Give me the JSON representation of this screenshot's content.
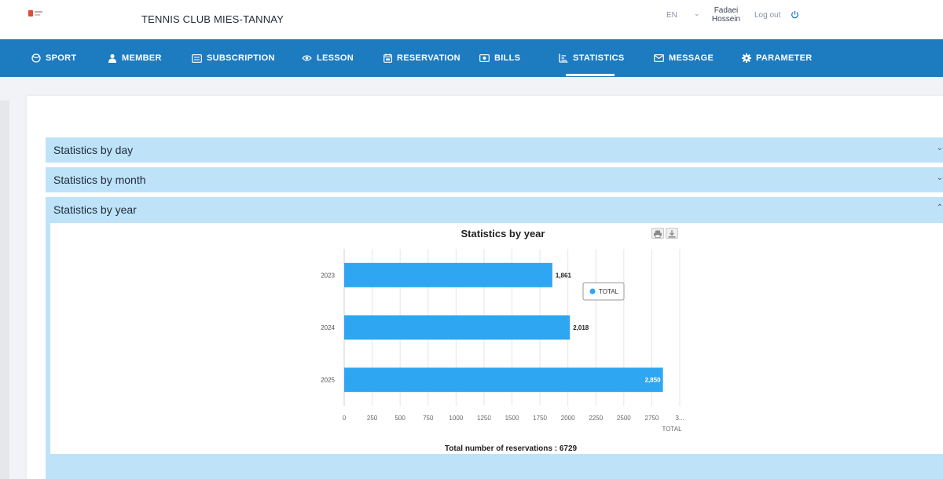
{
  "header": {
    "club_name": "TENNIS CLUB MIES-TANNAY",
    "language": "EN",
    "user_name_line1": "Fadaei",
    "user_name_line2": "Hossein",
    "logout_label": "Log out"
  },
  "nav": {
    "items": [
      {
        "label": "SPORT",
        "icon": "sport-icon"
      },
      {
        "label": "MEMBER",
        "icon": "member-icon"
      },
      {
        "label": "SUBSCRIPTION",
        "icon": "subscription-icon"
      },
      {
        "label": "LESSON",
        "icon": "lesson-icon"
      },
      {
        "label": "RESERVATION",
        "icon": "calendar-icon"
      },
      {
        "label": "BILLS",
        "icon": "bills-icon"
      },
      {
        "label": "STATISTICS",
        "icon": "statistics-icon"
      },
      {
        "label": "MESSAGE",
        "icon": "mail-icon"
      },
      {
        "label": "PARAMETER",
        "icon": "gear-icon"
      }
    ],
    "active": "STATISTICS",
    "active_color": "#ffffff",
    "bar_color": "#1d7bc0"
  },
  "sections": {
    "day": "Statistics by day",
    "month": "Statistics by month",
    "year": "Statistics by year"
  },
  "chart": {
    "title": "Statistics by year",
    "total_text": "Total number of reservations : 6729"
  },
  "chart_data": {
    "type": "bar",
    "orientation": "horizontal",
    "title": "Statistics by year",
    "categories": [
      "2023",
      "2024",
      "2025"
    ],
    "series": [
      {
        "name": "TOTAL",
        "values": [
          1861,
          2018,
          2850
        ],
        "labels": [
          "1,861",
          "2,018",
          "2,850"
        ],
        "color": "#2ea6f2"
      }
    ],
    "value_axis_ticks": [
      "0",
      "250",
      "500",
      "750",
      "1000",
      "1250",
      "1500",
      "1750",
      "2000",
      "2250",
      "2500",
      "2750",
      "3..."
    ],
    "value_axis_label": "TOTAL",
    "xlim": [
      0,
      3000
    ],
    "grid": true,
    "legend_position": "right"
  }
}
